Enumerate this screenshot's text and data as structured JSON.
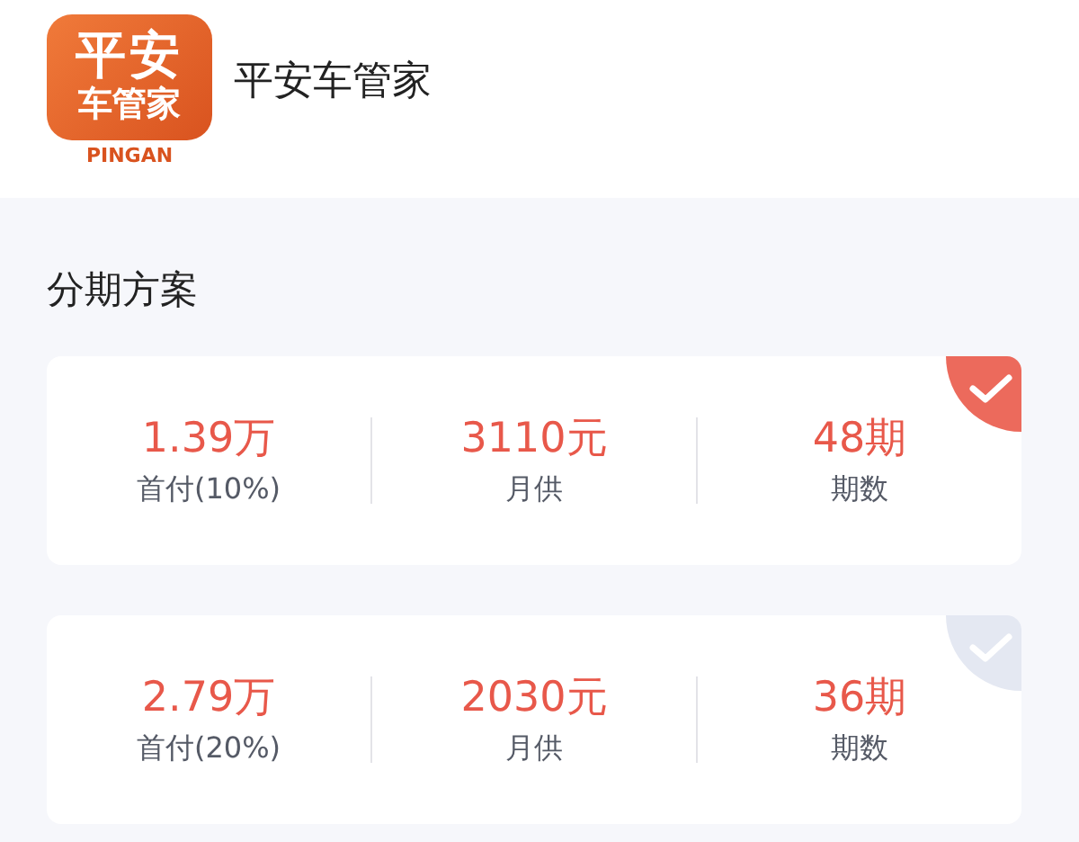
{
  "header": {
    "logo": {
      "line_1": "平安",
      "line_2": "车管家",
      "brand": "PINGAN"
    },
    "title": "平安车管家"
  },
  "section_title": "分期方案",
  "plans": [
    {
      "selected": true,
      "items": [
        {
          "value": "1.39万",
          "label": "首付(10%)"
        },
        {
          "value": "3110元",
          "label": "月供"
        },
        {
          "value": "48期",
          "label": "期数"
        }
      ]
    },
    {
      "selected": false,
      "items": [
        {
          "value": "2.79万",
          "label": "首付(20%)"
        },
        {
          "value": "2030元",
          "label": "月供"
        },
        {
          "value": "36期",
          "label": "期数"
        }
      ]
    }
  ]
}
